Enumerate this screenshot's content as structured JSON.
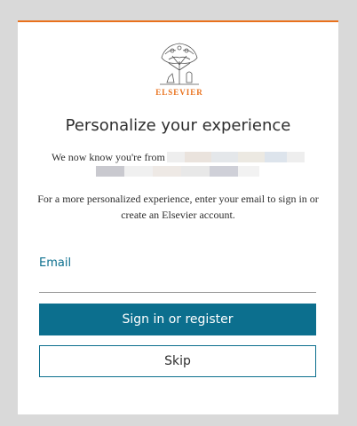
{
  "logo": {
    "wordmark": "ELSEVIER",
    "icon": "elsevier-tree-logo"
  },
  "heading": "Personalize your experience",
  "org_prefix": "We now know you're from",
  "description": "For a more personalized experience, enter your email to sign in or create an Elsevier account.",
  "email": {
    "label": "Email",
    "value": "",
    "placeholder": ""
  },
  "buttons": {
    "primary": "Sign in or register",
    "secondary": "Skip"
  },
  "colors": {
    "accent": "#0c6f8e",
    "brand_orange": "#e9711c",
    "page_bg": "#d9d9d9"
  }
}
